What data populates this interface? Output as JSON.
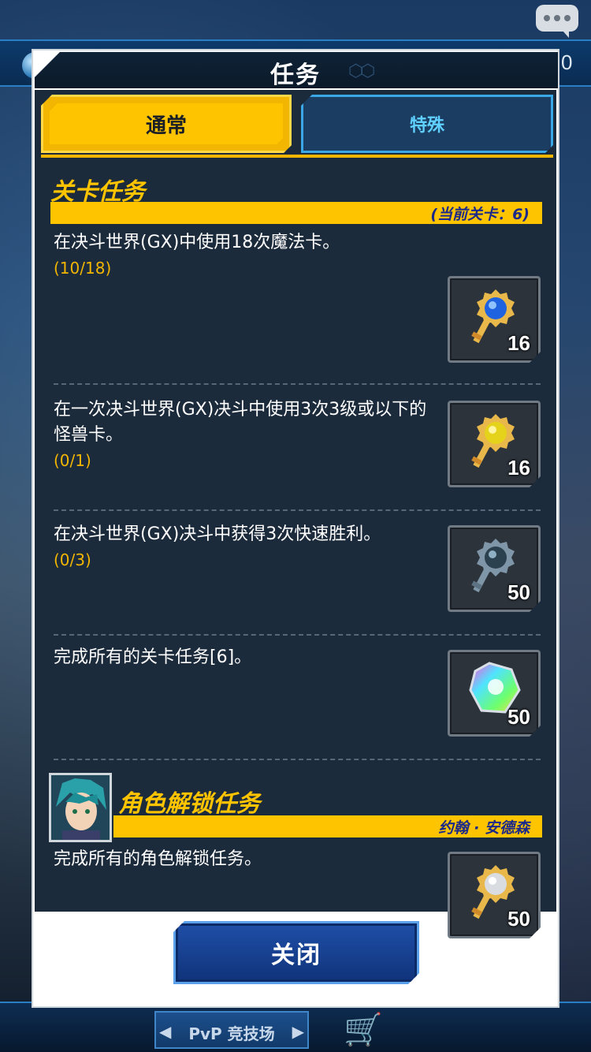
{
  "background": {
    "top_right_number": "0",
    "pvp_label": "PvP 竞技场"
  },
  "modal": {
    "title": "任务",
    "tabs": [
      {
        "label": "通常",
        "active": true
      },
      {
        "label": "特殊",
        "active": false
      }
    ],
    "close_label": "关闭"
  },
  "stage_section": {
    "title": "关卡任务",
    "current_stage": "(当前关卡：6)",
    "tasks": [
      {
        "text": "在决斗世界(GX)中使用18次魔法卡。",
        "progress": "(10/18)",
        "reward_icon": "blue-orb-key-icon",
        "reward_count": "16"
      },
      {
        "text": "在一次决斗世界(GX)决斗中使用3次3级或以下的怪兽卡。",
        "progress": "(0/1)",
        "reward_icon": "yellow-orb-key-icon",
        "reward_count": "16"
      },
      {
        "text": "在决斗世界(GX)决斗中获得3次快速胜利。",
        "progress": "(0/3)",
        "reward_icon": "silver-key-icon",
        "reward_count": "50"
      },
      {
        "text": "完成所有的关卡任务[6]。",
        "progress": "",
        "reward_icon": "rainbow-gem-icon",
        "reward_count": "50"
      }
    ]
  },
  "character_section": {
    "title": "角色解锁任务",
    "character_name": "约翰 · 安德森",
    "tasks": [
      {
        "text": "完成所有的角色解锁任务。",
        "progress": "",
        "reward_icon": "white-orb-key-icon",
        "reward_count": "50"
      }
    ]
  },
  "colors": {
    "accent_yellow": "#ffc400",
    "panel_bg": "#1c2b3c",
    "progress_text": "#f2b600",
    "special_tab_text": "#5fd0ff",
    "close_button": "#1f4fa8"
  }
}
